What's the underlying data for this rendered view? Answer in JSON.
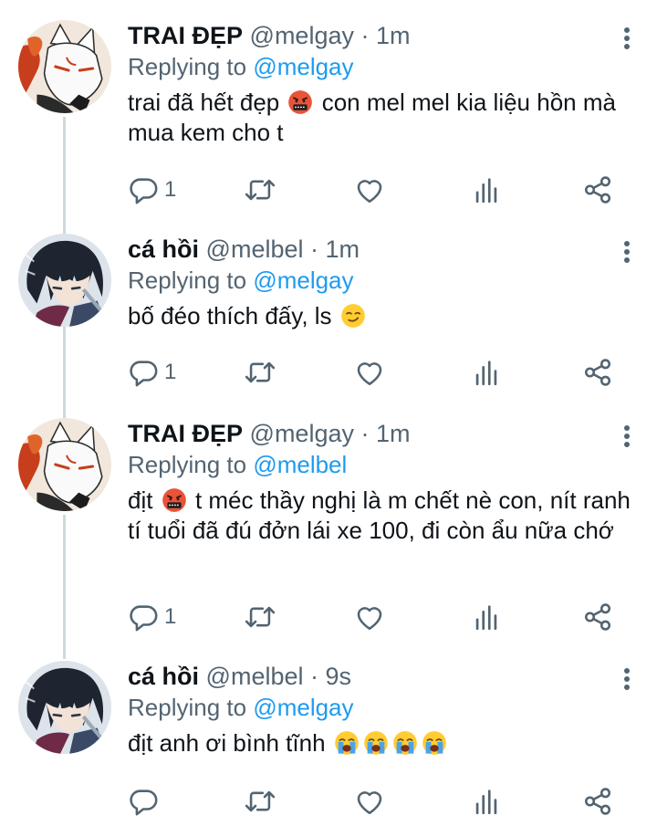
{
  "tweets": [
    {
      "name": "TRAI ĐẸP",
      "handle": "@melgay",
      "sep": "·",
      "time": "1m",
      "reply_prefix": "Replying to",
      "reply_to": "@melgay",
      "text_a": "trai đã hết đẹp",
      "text_b": "con mel mel kia liệu hồn mà mua kem cho t",
      "reply_count": "1",
      "avatar_icon": "fox-mask-avatar"
    },
    {
      "name": "cá hồi",
      "handle": "@melbel",
      "sep": "·",
      "time": "1m",
      "reply_prefix": "Replying to",
      "reply_to": "@melgay",
      "text_a": "bố đéo thích đấy, ls",
      "reply_count": "1",
      "avatar_icon": "anime-boy-avatar"
    },
    {
      "name": "TRAI ĐẸP",
      "handle": "@melgay",
      "sep": "·",
      "time": "1m",
      "reply_prefix": "Replying to",
      "reply_to": "@melbel",
      "text_a": "địt",
      "text_b": "t méc thầy nghị là m chết nè con, nít ranh tí tuổi đã đú đởn lái xe 100, đi còn ẩu nữa chớ",
      "reply_count": "1",
      "avatar_icon": "fox-mask-avatar"
    },
    {
      "name": "cá hồi",
      "handle": "@melbel",
      "sep": "·",
      "time": "9s",
      "reply_prefix": "Replying to",
      "reply_to": "@melgay",
      "text_a": "địt anh ơi bình tĩnh",
      "reply_count": "",
      "avatar_icon": "anime-boy-avatar"
    }
  ],
  "colors": {
    "text": "#0f1419",
    "secondary": "#536471",
    "link": "#1d9bf0",
    "thread_line": "#cfd9de"
  },
  "icons": [
    "reply-icon",
    "retweet-icon",
    "like-icon",
    "analytics-icon",
    "share-icon",
    "more-icon",
    "cursing-face-emoji",
    "smirk-emoji",
    "loudly-crying-emoji"
  ]
}
